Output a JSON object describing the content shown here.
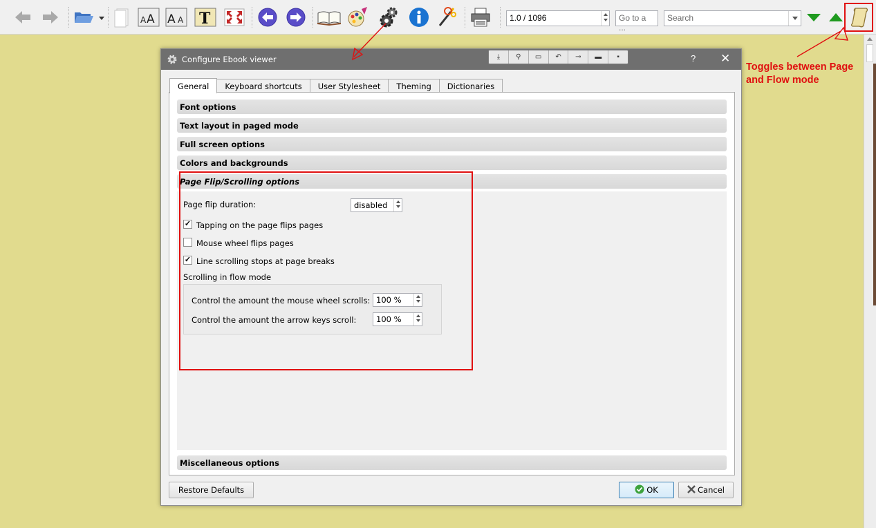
{
  "toolbar": {
    "page_value": "1.0 / 1096",
    "goto_placeholder": "Go to a ...",
    "search_placeholder": "Search"
  },
  "annotation": {
    "text": "Toggles between Page and Flow mode",
    "color": "#e01010"
  },
  "dialog": {
    "title": "Configure Ebook viewer",
    "help_label": "?",
    "close_label": "✕",
    "tabs": [
      {
        "label": "General",
        "active": true
      },
      {
        "label": "Keyboard shortcuts",
        "active": false
      },
      {
        "label": "User Stylesheet",
        "active": false
      },
      {
        "label": "Theming",
        "active": false
      },
      {
        "label": "Dictionaries",
        "active": false
      }
    ],
    "sections": [
      {
        "label": "Font options"
      },
      {
        "label": "Text layout in paged mode"
      },
      {
        "label": "Full screen options"
      },
      {
        "label": "Colors and backgrounds"
      },
      {
        "label": "Page Flip/Scrolling options"
      },
      {
        "label": "Miscellaneous options"
      }
    ],
    "page_flip": {
      "duration_label": "Page flip duration:",
      "duration_value": "disabled",
      "tap_flip_label": "Tapping on the page flips pages",
      "tap_flip_checked": true,
      "wheel_flip_label": "Mouse wheel flips pages",
      "wheel_flip_checked": false,
      "line_scroll_label": "Line scrolling stops at page breaks",
      "line_scroll_checked": true,
      "flow_group_label": "Scrolling in flow mode",
      "wheel_amount_label": "Control the amount the mouse wheel scrolls:",
      "wheel_amount_value": "100 %",
      "arrow_amount_label": "Control the amount the arrow keys scroll:",
      "arrow_amount_value": "100 %"
    },
    "buttons": {
      "restore": "Restore Defaults",
      "ok": "OK",
      "cancel": "Cancel"
    }
  },
  "colors": {
    "background": "#e1db8e",
    "annotation_red": "#e01010",
    "titlebar": "#6f6f6f"
  }
}
